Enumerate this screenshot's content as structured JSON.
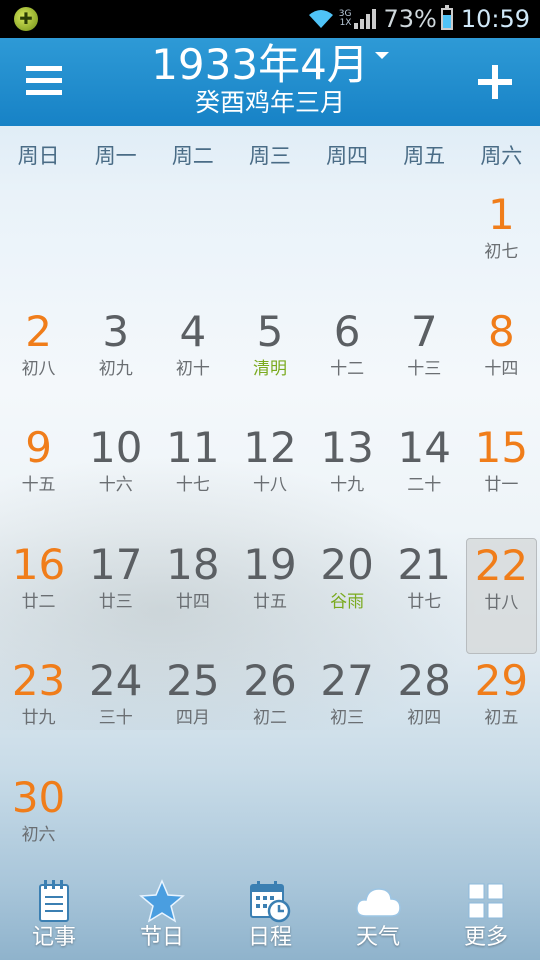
{
  "status_bar": {
    "app_icon": "app-notification-icon",
    "network_type_top": "3G",
    "network_type_bottom": "1X",
    "battery_percent": "73%",
    "battery_level": 0.73,
    "time": "10:59"
  },
  "header": {
    "month_title": "1933年4月",
    "lunar_title": "癸酉鸡年三月",
    "menu_icon": "hamburger-menu-icon",
    "add_icon": "plus-icon",
    "colors": {
      "bar": "#1f8ccf"
    }
  },
  "weekdays": [
    "周日",
    "周一",
    "周二",
    "周三",
    "周四",
    "周五",
    "周六"
  ],
  "days": [
    {
      "day": "1",
      "lunar": "初七",
      "col": 6,
      "row": 0,
      "weekend": true
    },
    {
      "day": "2",
      "lunar": "初八",
      "col": 0,
      "row": 1,
      "weekend": true
    },
    {
      "day": "3",
      "lunar": "初九",
      "col": 1,
      "row": 1
    },
    {
      "day": "4",
      "lunar": "初十",
      "col": 2,
      "row": 1
    },
    {
      "day": "5",
      "lunar": "清明",
      "col": 3,
      "row": 1,
      "term": true
    },
    {
      "day": "6",
      "lunar": "十二",
      "col": 4,
      "row": 1
    },
    {
      "day": "7",
      "lunar": "十三",
      "col": 5,
      "row": 1
    },
    {
      "day": "8",
      "lunar": "十四",
      "col": 6,
      "row": 1,
      "weekend": true
    },
    {
      "day": "9",
      "lunar": "十五",
      "col": 0,
      "row": 2,
      "weekend": true
    },
    {
      "day": "10",
      "lunar": "十六",
      "col": 1,
      "row": 2
    },
    {
      "day": "11",
      "lunar": "十七",
      "col": 2,
      "row": 2
    },
    {
      "day": "12",
      "lunar": "十八",
      "col": 3,
      "row": 2
    },
    {
      "day": "13",
      "lunar": "十九",
      "col": 4,
      "row": 2
    },
    {
      "day": "14",
      "lunar": "二十",
      "col": 5,
      "row": 2
    },
    {
      "day": "15",
      "lunar": "廿一",
      "col": 6,
      "row": 2,
      "weekend": true
    },
    {
      "day": "16",
      "lunar": "廿二",
      "col": 0,
      "row": 3,
      "weekend": true
    },
    {
      "day": "17",
      "lunar": "廿三",
      "col": 1,
      "row": 3
    },
    {
      "day": "18",
      "lunar": "廿四",
      "col": 2,
      "row": 3
    },
    {
      "day": "19",
      "lunar": "廿五",
      "col": 3,
      "row": 3
    },
    {
      "day": "20",
      "lunar": "谷雨",
      "col": 4,
      "row": 3,
      "term": true
    },
    {
      "day": "21",
      "lunar": "廿七",
      "col": 5,
      "row": 3
    },
    {
      "day": "22",
      "lunar": "廿八",
      "col": 6,
      "row": 3,
      "weekend": true,
      "selected": true
    },
    {
      "day": "23",
      "lunar": "廿九",
      "col": 0,
      "row": 4,
      "weekend": true
    },
    {
      "day": "24",
      "lunar": "三十",
      "col": 1,
      "row": 4
    },
    {
      "day": "25",
      "lunar": "四月",
      "col": 2,
      "row": 4
    },
    {
      "day": "26",
      "lunar": "初二",
      "col": 3,
      "row": 4
    },
    {
      "day": "27",
      "lunar": "初三",
      "col": 4,
      "row": 4
    },
    {
      "day": "28",
      "lunar": "初四",
      "col": 5,
      "row": 4
    },
    {
      "day": "29",
      "lunar": "初五",
      "col": 6,
      "row": 4,
      "weekend": true
    },
    {
      "day": "30",
      "lunar": "初六",
      "col": 0,
      "row": 5,
      "weekend": true
    }
  ],
  "colors": {
    "weekend": "#f07d1a",
    "solar_term": "#7aaa1e",
    "normal_day": "#5b5f63"
  },
  "tabs": [
    {
      "label": "记事",
      "icon": "notepad-icon"
    },
    {
      "label": "节日",
      "icon": "star-icon"
    },
    {
      "label": "日程",
      "icon": "calendar-clock-icon"
    },
    {
      "label": "天气",
      "icon": "cloud-icon"
    },
    {
      "label": "更多",
      "icon": "grid-more-icon"
    }
  ]
}
